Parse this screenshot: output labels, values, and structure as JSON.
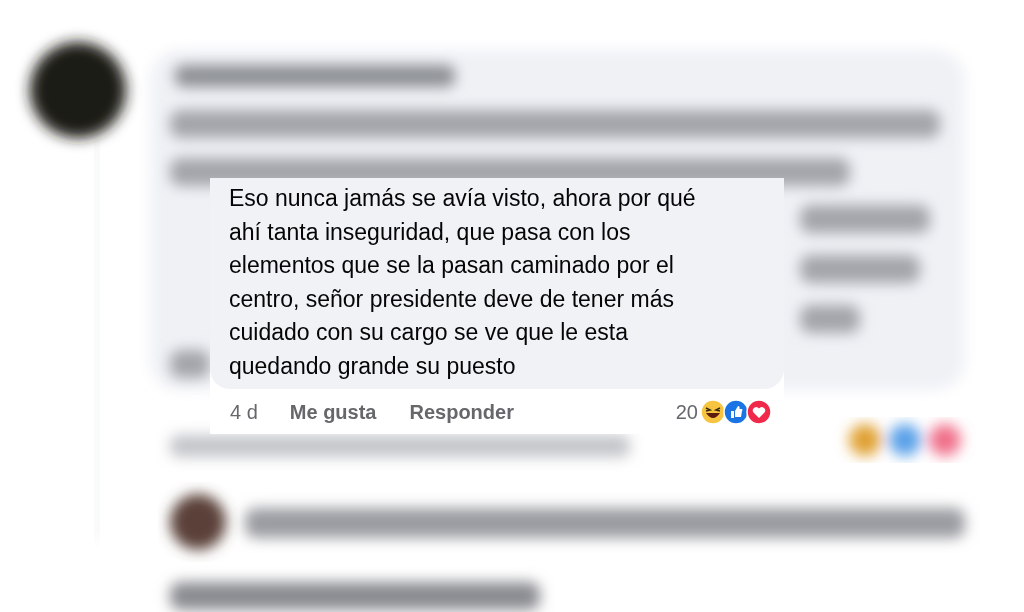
{
  "comment": {
    "text_lines": [
      "Eso nunca jamás se avía visto, ahora por qué",
      "ahí tanta inseguridad, que pasa con los",
      "elementos que se la pasan caminado por el",
      "centro, señor presidente deve de tener más",
      "cuidado con su cargo se ve que le esta",
      "quedando grande su puesto"
    ],
    "time": "4 d",
    "actions": [
      "Me gusta",
      "Responder"
    ],
    "reaction_count": "20"
  }
}
